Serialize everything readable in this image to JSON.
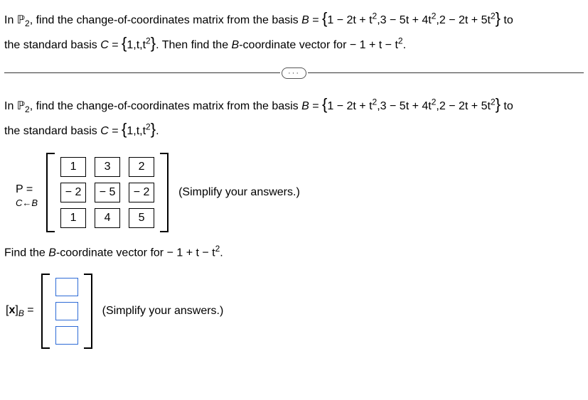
{
  "p1": {
    "line1_a": "In ",
    "line1_p": "ℙ",
    "line1_sub": "2",
    "line1_b": ", find the change-of-coordinates matrix from the basis ",
    "line1_B": "B",
    "line1_eq": " = ",
    "set_open": "{",
    "poly1": "1 − 2t + t",
    "poly1_sup": "2",
    "poly_sep1": ",",
    "poly2": "3 − 5t + 4t",
    "poly2_sup": "2",
    "poly_sep2": ",",
    "poly3": "2 − 2t + 5t",
    "poly3_sup": "2",
    "set_close": "}",
    "line1_to": " to",
    "line2_a": "the standard basis ",
    "line2_C": "C",
    "line2_eq": " = ",
    "c_open": "{",
    "c_body": "1,t,t",
    "c_sup": "2",
    "c_close": "}",
    "line2_b": ". Then find the ",
    "line2_B2": "B",
    "line2_c": "-coordinate vector for  − 1 + t − t",
    "line2_sup": "2",
    "line2_d": "."
  },
  "divider": "···",
  "p2": {
    "line1_a": "In ",
    "line1_p": "ℙ",
    "line1_sub": "2",
    "line1_b": ", find the change-of-coordinates matrix from the basis ",
    "line1_B": "B",
    "line1_eq": " = ",
    "set_open": "{",
    "poly1": "1 − 2t + t",
    "poly1_sup": "2",
    "poly_sep1": ",",
    "poly2": "3 − 5t + 4t",
    "poly2_sup": "2",
    "poly_sep2": ",",
    "poly3": "2 − 2t + 5t",
    "poly3_sup": "2",
    "set_close": "}",
    "line1_to": " to",
    "line2_a": "the standard basis ",
    "line2_C": "C",
    "line2_eq": " = ",
    "c_open": "{",
    "c_body": "1,t,t",
    "c_sup": "2",
    "c_close": "}",
    "line2_d": "."
  },
  "matrix": {
    "label_top": "P   =",
    "label_bot": "C←B",
    "cells": {
      "r0c0": "1",
      "r0c1": "3",
      "r0c2": "2",
      "r1c0": "− 2",
      "r1c1": "− 5",
      "r1c2": "− 2",
      "r2c0": "1",
      "r2c1": "4",
      "r2c2": "5"
    },
    "hint": "(Simplify your answers.)"
  },
  "p3": {
    "a": "Find the ",
    "B": "B",
    "b": "-coordinate vector for  − 1 + t − t",
    "sup": "2",
    "c": "."
  },
  "vec": {
    "label_a": "[",
    "label_x": "x",
    "label_b": "]",
    "label_sub": "B",
    "label_eq": " =",
    "hint": "(Simplify your answers.)"
  }
}
